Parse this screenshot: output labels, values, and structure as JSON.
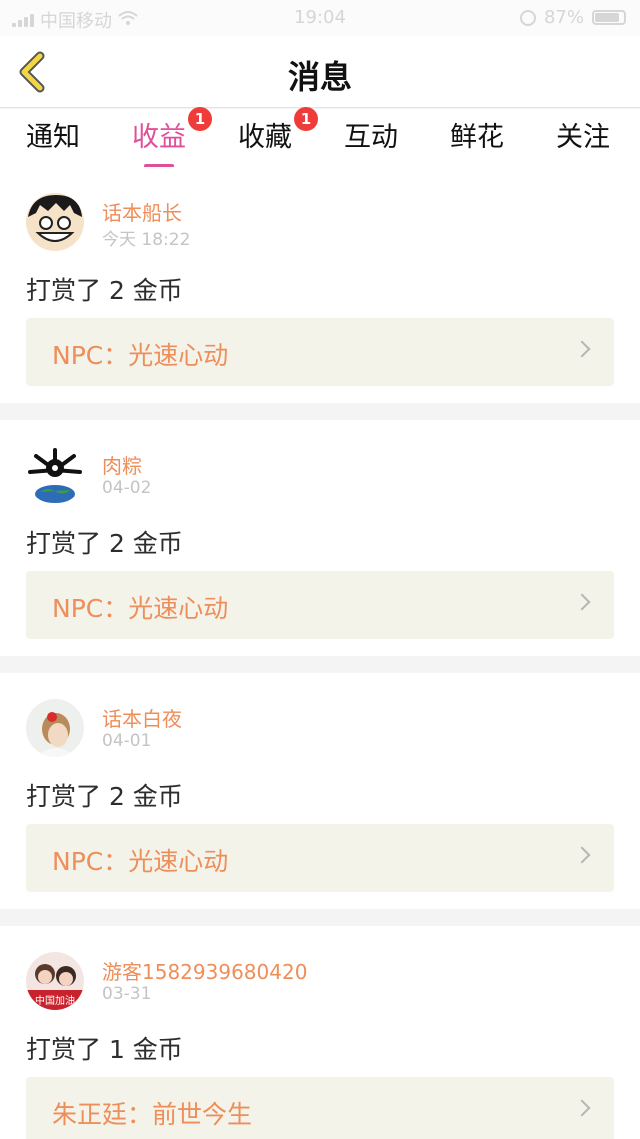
{
  "status_bar": {
    "carrier": "中国移动",
    "time": "19:04",
    "battery": "87%"
  },
  "header": {
    "title": "消息"
  },
  "tabs": [
    {
      "label": "通知",
      "active": false,
      "badge": ""
    },
    {
      "label": "收益",
      "active": true,
      "badge": "1"
    },
    {
      "label": "收藏",
      "active": false,
      "badge": "1"
    },
    {
      "label": "互动",
      "active": false,
      "badge": ""
    },
    {
      "label": "鲜花",
      "active": false,
      "badge": ""
    },
    {
      "label": "关注",
      "active": false,
      "badge": ""
    }
  ],
  "messages": [
    {
      "username": "话本船长",
      "date": "今天 18:22",
      "action": "打赏了 2 金币",
      "link": "NPC：光速心动"
    },
    {
      "username": "肉粽",
      "date": "04-02",
      "action": "打赏了 2 金币",
      "link": "NPC：光速心动"
    },
    {
      "username": "话本白夜",
      "date": "04-01",
      "action": "打赏了 2 金币",
      "link": "NPC：光速心动"
    },
    {
      "username": "游客1582939680420",
      "date": "03-31",
      "action": "打赏了 1 金币",
      "link": "朱正廷：前世今生",
      "avatar_text": "中国加油"
    }
  ],
  "colors": {
    "accent": "#e0509a",
    "username": "#ee8e5a",
    "badge": "#f03b3b",
    "link_bg": "#f3f3ea"
  }
}
